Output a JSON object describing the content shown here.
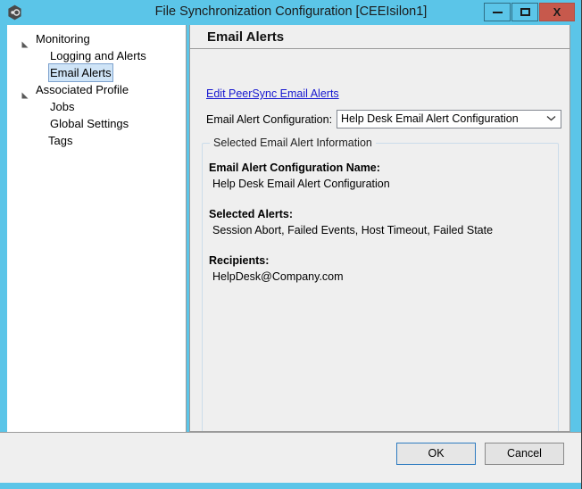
{
  "window": {
    "title": "File Synchronization Configuration [CEEIsilon1]",
    "app_icon": "hexagon-gear-icon",
    "accent_color": "#5BC5E8",
    "close_color": "#C7594C",
    "controls": {
      "minimize_label": "–",
      "maximize_label": "□",
      "close_label": "X"
    }
  },
  "sidebar": {
    "items": [
      {
        "label": "Monitoring",
        "level": 0,
        "expander": "expanded",
        "selected": false,
        "name": "sidebar-item-monitoring"
      },
      {
        "label": "Logging and Alerts",
        "level": 1,
        "expander": "none",
        "selected": false,
        "name": "sidebar-item-logging-and-alerts"
      },
      {
        "label": "Email Alerts",
        "level": 1,
        "expander": "none",
        "selected": true,
        "name": "sidebar-item-email-alerts"
      },
      {
        "label": "Associated Profile",
        "level": 0,
        "expander": "expanded",
        "selected": false,
        "name": "sidebar-item-associated-profile"
      },
      {
        "label": "Jobs",
        "level": 1,
        "expander": "none",
        "selected": false,
        "name": "sidebar-item-jobs"
      },
      {
        "label": "Global Settings",
        "level": 1,
        "expander": "none",
        "selected": false,
        "name": "sidebar-item-global-settings"
      },
      {
        "label": "Tags",
        "level": 0,
        "expander": "none",
        "selected": false,
        "name": "sidebar-item-tags"
      }
    ]
  },
  "content": {
    "header": "Email Alerts",
    "edit_link": "Edit PeerSync Email Alerts",
    "edit_link_color": "#1718D0",
    "config_label": "Email Alert Configuration:",
    "config_select": {
      "value": "Help Desk Email Alert Configuration",
      "chevron": "⌄",
      "options": [
        "Help Desk Email Alert Configuration"
      ]
    },
    "groupbox": {
      "legend": "Selected Email Alert Information",
      "fields": [
        {
          "key": "Email Alert Configuration Name:",
          "value": "Help Desk Email Alert Configuration"
        },
        {
          "key": "Selected Alerts:",
          "value": "Session Abort, Failed Events, Host Timeout, Failed State"
        },
        {
          "key": "Recipients:",
          "value": "HelpDesk@Company.com"
        }
      ]
    }
  },
  "footer": {
    "ok_label": "OK",
    "cancel_label": "Cancel",
    "focus_color": "#2E7BC0"
  }
}
